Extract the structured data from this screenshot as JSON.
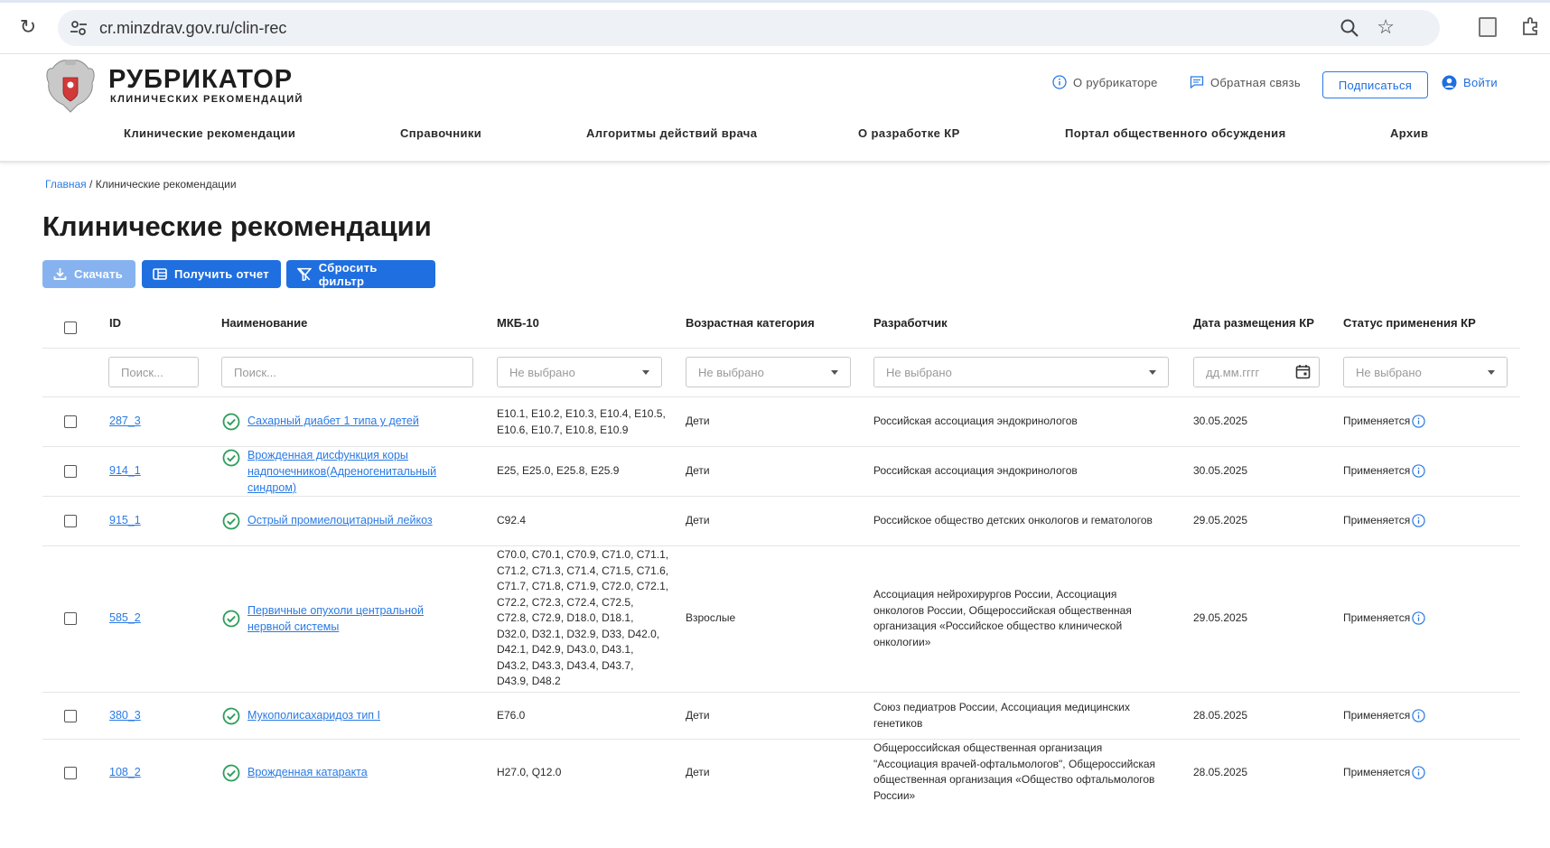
{
  "browser": {
    "url": "cr.minzdrav.gov.ru/clin-rec"
  },
  "header": {
    "logo_title": "РУБРИКАТОР",
    "logo_subtitle": "КЛИНИЧЕСКИХ РЕКОМЕНДАЦИЙ",
    "about_label": "О рубрикаторе",
    "feedback_label": "Обратная связь",
    "subscribe_label": "Подписаться",
    "login_label": "Войти",
    "accent_color": "#1f6fe0"
  },
  "nav": {
    "items": [
      {
        "label": "Клинические рекомендации"
      },
      {
        "label": "Справочники"
      },
      {
        "label": "Алгоритмы действий врача"
      },
      {
        "label": "О разработке КР"
      },
      {
        "label": "Портал общественного обсуждения"
      },
      {
        "label": "Архив"
      }
    ]
  },
  "breadcrumb": {
    "home": "Главная",
    "separator": " / ",
    "current": "Клинические рекомендации"
  },
  "page": {
    "title": "Клинические рекомендации"
  },
  "toolbar": {
    "download_label": "Скачать",
    "report_label": "Получить отчет",
    "reset_label": "Сбросить фильтр"
  },
  "table": {
    "columns": [
      "ID",
      "Наименование",
      "МКБ-10",
      "Возрастная категория",
      "Разработчик",
      "Дата размещения КР",
      "Статус применения КР"
    ],
    "filters": {
      "id_placeholder": "Поиск...",
      "name_placeholder": "Поиск...",
      "mkb_value": "Не выбрано",
      "age_value": "Не выбрано",
      "dev_value": "Не выбрано",
      "date_placeholder": "дд.мм.гггг",
      "status_value": "Не выбрано"
    },
    "rows": [
      {
        "id": "287_3",
        "name": [
          "Сахарный диабет 1 типа у детей"
        ],
        "mkb": [
          "E10.1, E10.2, E10.3, E10.4, E10.5,",
          "E10.6, E10.7, E10.8, E10.9"
        ],
        "age": "Дети",
        "developer": [
          "Российская ассоциация эндокринологов"
        ],
        "date": "30.05.2025",
        "status": "Применяется"
      },
      {
        "id": "914_1",
        "name": [
          "Врожденная дисфункция коры",
          "надпочечников(Адреногенитальный",
          "синдром)"
        ],
        "mkb": [
          "E25, E25.0, E25.8, E25.9"
        ],
        "age": "Дети",
        "developer": [
          "Российская ассоциация эндокринологов"
        ],
        "date": "30.05.2025",
        "status": "Применяется"
      },
      {
        "id": "915_1",
        "name": [
          "Острый промиелоцитарный лейкоз"
        ],
        "mkb": [
          "C92.4"
        ],
        "age": "Дети",
        "developer": [
          "Российское общество детских онкологов и гематологов"
        ],
        "date": "29.05.2025",
        "status": "Применяется"
      },
      {
        "id": "585_2",
        "name": [
          "Первичные опухоли центральной",
          "нервной системы"
        ],
        "mkb": [
          "C70.0, C70.1, C70.9, C71.0, C71.1,",
          "C71.2, C71.3, C71.4, C71.5, C71.6,",
          "C71.7, C71.8, C71.9, C72.0, C72.1,",
          "C72.2, C72.3, C72.4, C72.5,",
          "C72.8, C72.9, D18.0, D18.1,",
          "D32.0, D32.1, D32.9, D33, D42.0,",
          "D42.1, D42.9, D43.0, D43.1,",
          "D43.2, D43.3, D43.4, D43.7,",
          "D43.9, D48.2"
        ],
        "age": "Взрослые",
        "developer": [
          "Ассоциация нейрохирургов России, Ассоциация",
          "онкологов России, Общероссийская общественная",
          "организация «Российское общество клинической",
          "онкологии»"
        ],
        "date": "29.05.2025",
        "status": "Применяется"
      },
      {
        "id": "380_3",
        "name": [
          "Мукополисахаридоз тип I"
        ],
        "mkb": [
          "E76.0"
        ],
        "age": "Дети",
        "developer": [
          "Союз педиатров России, Ассоциация медицинских",
          "генетиков"
        ],
        "date": "28.05.2025",
        "status": "Применяется"
      },
      {
        "id": "108_2",
        "name": [
          "Врожденная катаракта"
        ],
        "mkb": [
          "H27.0, Q12.0"
        ],
        "age": "Дети",
        "developer": [
          "Общероссийская общественная организация",
          "\"Ассоциация врачей-офтальмологов\", Общероссийская",
          "общественная организация «Общество офтальмологов",
          "России»"
        ],
        "date": "28.05.2025",
        "status": "Применяется"
      }
    ]
  }
}
